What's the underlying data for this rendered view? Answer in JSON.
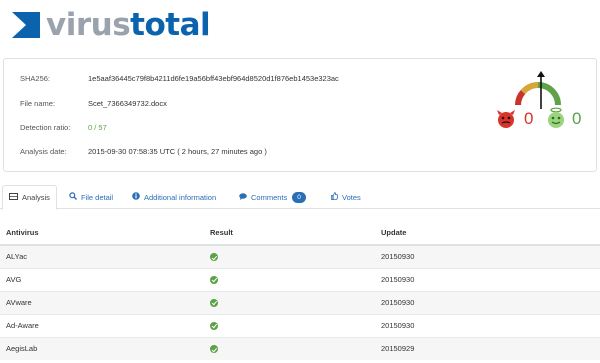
{
  "brand": {
    "name_part1": "virus",
    "name_part2": "total",
    "accent": "#0b63ad",
    "gray": "#9aa3ad"
  },
  "file_info": {
    "sha256_label": "SHA256:",
    "sha256_value": "1e5aaf36445c79f8b4211d6fe19a56bff43ebf964d8520d1f876eb1453e323ac",
    "filename_label": "File name:",
    "filename_value": "Scet_7366349732.docx",
    "detection_label": "Detection ratio:",
    "detection_value": "0 / 57",
    "date_label": "Analysis date:",
    "date_value": "2015-09-30 07:58:35 UTC ( 2 hours, 27 minutes ago )"
  },
  "votes": {
    "malicious": "0",
    "harmless": "0",
    "bad_color": "#d9342b",
    "good_color": "#5aa244"
  },
  "tabs": [
    {
      "label": "Analysis",
      "icon": "table-icon"
    },
    {
      "label": "File detail",
      "icon": "search-icon"
    },
    {
      "label": "Additional information",
      "icon": "info-icon"
    },
    {
      "label": "Comments",
      "icon": "comment-icon",
      "badge": "0"
    },
    {
      "label": "Votes",
      "icon": "thumbs-up-icon"
    }
  ],
  "table": {
    "headers": [
      "Antivirus",
      "Result",
      "Update"
    ],
    "rows": [
      {
        "antivirus": "ALYac",
        "result": "clean-check-icon",
        "update": "20150930"
      },
      {
        "antivirus": "AVG",
        "result": "clean-check-icon",
        "update": "20150930"
      },
      {
        "antivirus": "AVware",
        "result": "clean-check-icon",
        "update": "20150930"
      },
      {
        "antivirus": "Ad-Aware",
        "result": "clean-check-icon",
        "update": "20150930"
      },
      {
        "antivirus": "AegisLab",
        "result": "clean-check-icon",
        "update": "20150929"
      }
    ]
  }
}
